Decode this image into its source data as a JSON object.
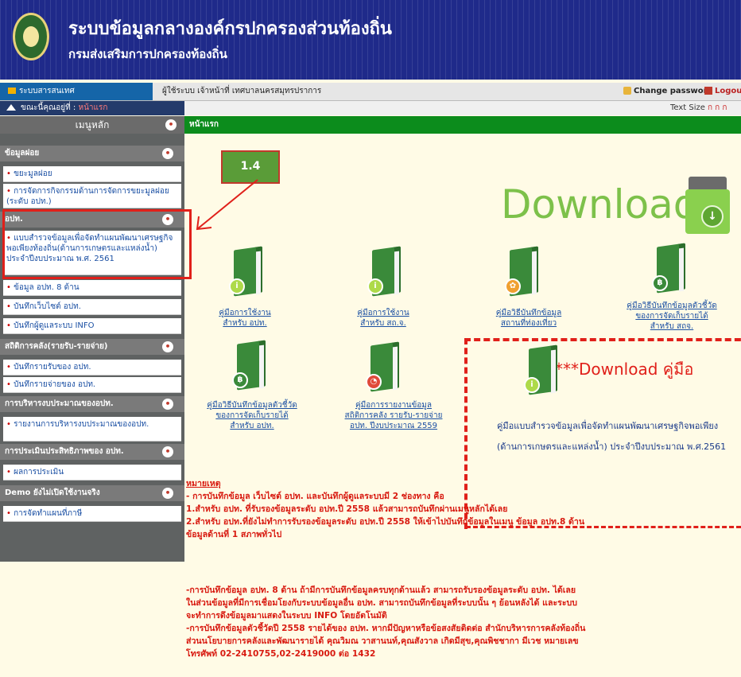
{
  "header": {
    "title": "ระบบข้อมูลกลางองค์กรปกครองส่วนท้องถิ่น",
    "subtitle": "กรมส่งเสริมการปกครองท้องถิ่น"
  },
  "userbar": {
    "system_tab": "ระบบสารสนเทศ",
    "user_text": "ผู้ใช้ระบบ เจ้าหน้าที่ เทศบาลนครสมุทรปราการ",
    "change_password": "Change password",
    "logout": "Logout"
  },
  "crumb": {
    "prefix": "ขณะนี้คุณอยู่ที่ :",
    "current": "หน้าแรก",
    "text_size": "Text Size",
    "sizes": "ก ก ก"
  },
  "sidebar": {
    "title": "เมนูหลัก",
    "sections": {
      "s1": "ข้อมูลฝอย",
      "s2": "อปท.",
      "s3": "สถิติการคลัง(รายรับ-รายจ่าย)",
      "s4": "การบริหารงบประมาณของอปท.",
      "s5": "การประเมินประสิทธิภาพของ อปท.",
      "s6": "Demo ยังไม่เปิดใช้งานจริง"
    },
    "items": {
      "i1": "ขยะมูลฝอย",
      "i2": "การจัดการกิจกรรมด้านการจัดการขยะมูลฝอย (ระดับ อปท.)",
      "i3": "แบบสำรวจข้อมูลเพื่อจัดทำแผนพัฒนาเศรษฐกิจพอเพียงท้องถิ่น(ด้านการเกษตรและแหล่งน้ำ) ประจำปีงบประมาณ พ.ศ. 2561",
      "i4": "ข้อมูล อปท. 8 ด้าน",
      "i5": "บันทึกเว็บไซต์ อปท.",
      "i6": "บันทึกผู้ดูแลระบบ INFO",
      "i7": "บันทึกรายรับของ อปท.",
      "i8": "บันทึกรายจ่ายของ อปท.",
      "i9": "รายงานการบริหารงบประมาณของอปท.",
      "i10": "ผลการประเมิน",
      "i11": "การจัดทำแผนที่ภาษี"
    }
  },
  "content": {
    "bar_title": "หน้าแรก",
    "download_word": "Download",
    "docs": {
      "d1": "คู่มือการใช้งาน\nสำหรับ อปท.",
      "d2": "คู่มือการใช้งาน\nสำหรับ สถ.จ.",
      "d3": "คู่มือวิธีบันทึกข้อมูล\nสถานที่ท่องเที่ยว",
      "d4": "คู่มือวิธีบันทึกข้อมูลตัวชี้วัด\nของการจัดเก็บรายได้\nสำหรับ สถจ.",
      "d5": "คู่มือวิธีบันทึกข้อมูลตัวชี้วัด\nของการจัดเก็บรายได้\nสำหรับ อปท.",
      "d6": "คู่มือการรายงานข้อมูล\nสถิติการคลัง รายรับ-รายจ่าย\nอปท. ปีงบประมาณ 2559"
    },
    "annotation_download": "***Download คู่มือ",
    "manual_text": "คู่มือแบบสำรวจข้อมูลเพื่อจัดทำแผนพัฒนาเศรษฐกิจพอเพียง (ด้านการเกษตรและแหล่งน้ำ) ประจำปีงบประมาณ พ.ศ.2561",
    "badge": "1.4",
    "notes": {
      "heading": "หมายเหตุ",
      "l1": "- การบันทึกข้อมูล เว็บไซต์ อปท. และบันทึกผู้ดูแลระบบมี 2 ช่องทาง คือ",
      "l2": "1.สำหรับ อปท. ที่รับรองข้อมูลระดับ อปท.ปี 2558 แล้วสามารถบันทึกผ่านเมนูหลักได้เลย",
      "l3": "2.สำหรับ อปท.ที่ยังไม่ทำการรับรองข้อมูลระดับ อปท.ปี 2558 ให้เข้าไปบันทึกข้อมูลในเมนู ข้อมูล อปท.8 ด้าน",
      "l4": "ข้อมูลด้านที่ 1 สภาพทั่วไป",
      "l5": "-การบันทึกข้อมูล อปท. 8 ด้าน ถ้ามีการบันทึกข้อมูลครบทุกด้านแล้ว สามารถรับรองข้อมูลระดับ อปท. ได้เลย",
      "l6": "ในส่วนข้อมูลที่มีการเชื่อมโยงกับระบบข้อมูลอื่น อปท. สามารถบันทึกข้อมูลที่ระบบนั้น ๆ ย้อนหลังได้ และระบบ",
      "l7": "จะทำการดึงข้อมูลมาแสดงในระบบ INFO โดยอัตโนมัติ",
      "l8": "-การบันทึกข้อมูลตัวชี้วัดปี 2558 รายได้ของ อปท. หากมีปัญหาหรือข้อสงสัยติดต่อ สำนักบริหารการคลังท้องถิ่น",
      "l9": "ส่วนนโยบายการคลังและพัฒนารายได้ คุณวิมณ วาสานนท์,คุณสังวาล เกิดมีสุข,คุณพิชชากา มีเวช หมายเลข",
      "l10": "โทรศัพท์ 02-2410755,02-2419000 ต่อ 1432"
    }
  },
  "colors": {
    "header_bg": "#1f2a8a",
    "sidebar_bg": "#5f6262",
    "content_bar": "#0c8c1c",
    "annotation_red": "#e0201a",
    "page_bg": "#fffbe6"
  }
}
